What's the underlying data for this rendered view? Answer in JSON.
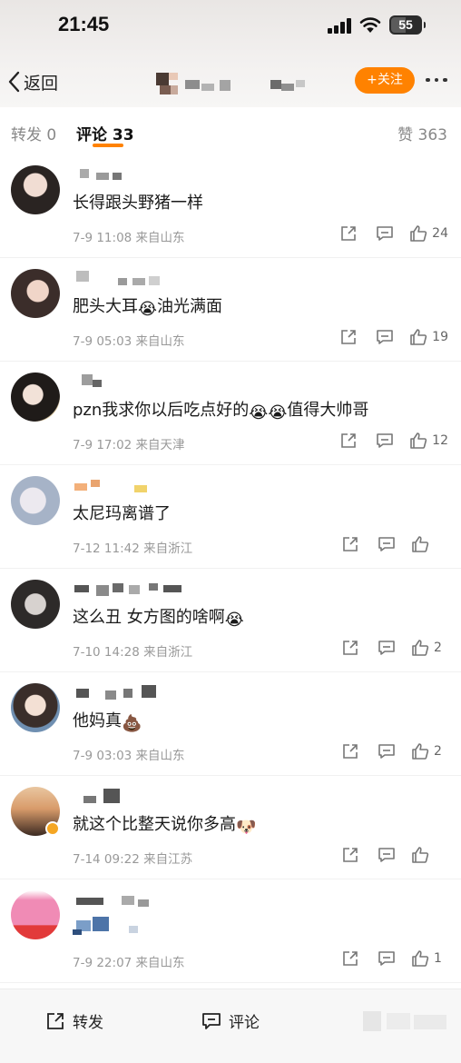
{
  "status_bar": {
    "time": "21:45",
    "battery": "55"
  },
  "nav": {
    "back_label": "返回",
    "follow_label": "+关注"
  },
  "tabs": {
    "forward": "转发 0",
    "comments": "评论 33",
    "likes": "赞 363"
  },
  "comments": [
    {
      "text": "长得跟头野猪一样",
      "date": "7-9 11:08",
      "location": "来自山东",
      "likes": "24"
    },
    {
      "text_before": "肥头大耳",
      "emoji": "😭",
      "text_after": "油光满面",
      "date": "7-9 05:03",
      "location": "来自山东",
      "likes": "19"
    },
    {
      "text_before": "pzn我求你以后吃点好的",
      "emoji": "😭😭",
      "text_after": "值得大帅哥",
      "date": "7-9 17:02",
      "location": "来自天津",
      "likes": "12"
    },
    {
      "text": "太尼玛离谱了",
      "date": "7-12 11:42",
      "location": "来自浙江",
      "likes": ""
    },
    {
      "text_before": "这么丑 女方图的啥啊",
      "emoji": "😭",
      "date": "7-10 14:28",
      "location": "来自浙江",
      "likes": "2"
    },
    {
      "text_before": "他妈真",
      "emoji": "💩",
      "date": "7-9 03:03",
      "location": "来自山东",
      "likes": "2"
    },
    {
      "text_before": "就这个比整天说你多高",
      "emoji": "🐶",
      "date": "7-14 09:22",
      "location": "来自江苏",
      "likes": ""
    },
    {
      "text": "",
      "date": "7-9 22:07",
      "location": "来自山东",
      "likes": "1"
    }
  ],
  "bottom_bar": {
    "forward_label": "转发",
    "comment_label": "评论"
  },
  "colors": {
    "accent": "#ff8200",
    "verified_badge": "#f5a623"
  },
  "icons": [
    "back-chevron-icon",
    "share-icon",
    "reply-icon",
    "like-thumb-icon",
    "more-dots-icon"
  ]
}
